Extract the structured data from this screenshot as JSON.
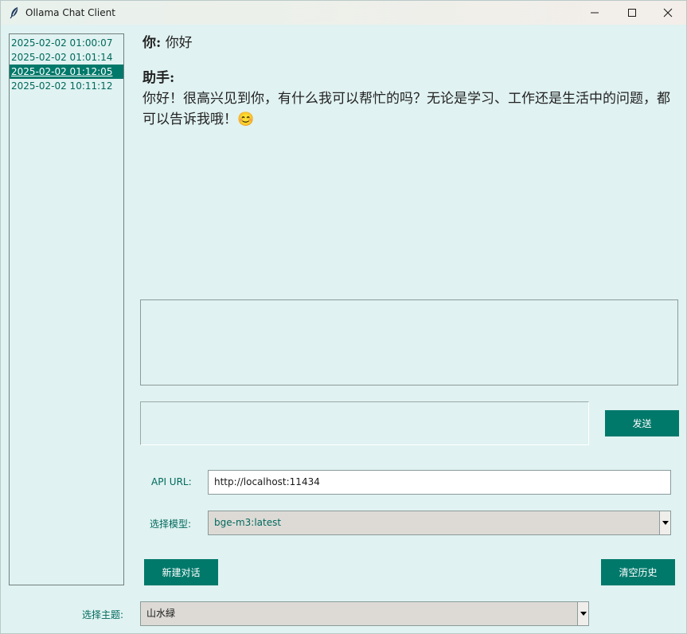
{
  "window": {
    "title": "Ollama Chat Client",
    "app_icon": "feather-icon",
    "controls": [
      "minimize-icon",
      "maximize-icon",
      "close-icon"
    ]
  },
  "history": {
    "items": [
      {
        "label": "2025-02-02 01:00:07",
        "selected": false
      },
      {
        "label": "2025-02-02 01:01:14",
        "selected": false
      },
      {
        "label": "2025-02-02 01:12:05",
        "selected": true
      },
      {
        "label": "2025-02-02 10:11:12",
        "selected": false
      }
    ]
  },
  "chat": {
    "user_role": "你:",
    "user_message": "你好",
    "assistant_role": "助手:",
    "assistant_message": "你好！很高兴见到你，有什么我可以帮忙的吗？无论是学习、工作还是生活中的问题，都可以告诉我哦！😊"
  },
  "input": {
    "message_value": "",
    "send_label": "发送"
  },
  "settings": {
    "api_url_label": "API URL:",
    "api_url_value": "http://localhost:11434",
    "model_label": "选择模型:",
    "model_value": "bge-m3:latest",
    "theme_label": "选择主题:",
    "theme_value": "山水緑"
  },
  "actions": {
    "new_chat_label": "新建对话",
    "clear_history_label": "清空历史"
  },
  "colors": {
    "background": "#e0f2f1",
    "accent": "#00796b",
    "label_text": "#00695c",
    "combo_bg": "#dddad6"
  }
}
